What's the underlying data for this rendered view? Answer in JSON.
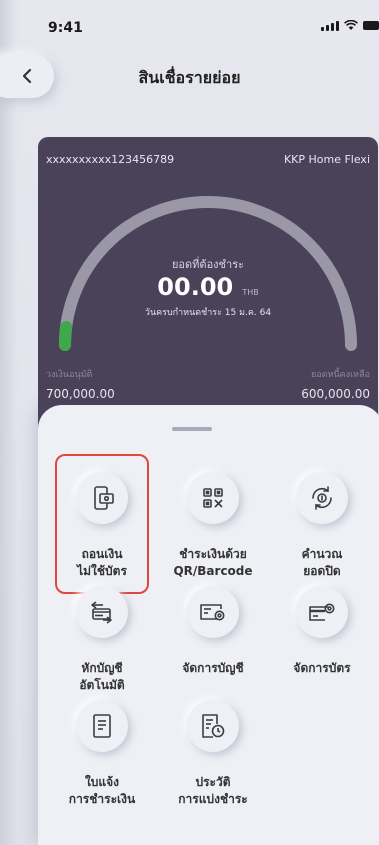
{
  "status_bar": {
    "time": "9:41"
  },
  "header": {
    "title": "สินเชื่อรายย่อย"
  },
  "card": {
    "account_number": "xxxxxxxxxx123456789",
    "product_name": "KKP Home Flexi",
    "due_label": "ยอดที่ต้องชำระ",
    "amount": "00.00",
    "currency": "THB",
    "due_date": "วันครบกำหนดชำระ 15 ม.ค. 64",
    "limit_label": "วงเงินอนุมัติ",
    "limit_value": "700,000.00",
    "remaining_label": "ยอดหนี้คงเหลือ",
    "remaining_value": "600,000.00",
    "gauge_color": "#9a98a6",
    "gauge_progress_color": "#3fa84a"
  },
  "menu": {
    "items": [
      {
        "label": "ถอนเงิน\nไม่ใช้บัตร",
        "icon": "phone-cash-icon",
        "highlighted": true
      },
      {
        "label": "ชำระเงินด้วย\nQR/Barcode",
        "icon": "qr-code-icon"
      },
      {
        "label": "คำนวณ\nยอดปิด",
        "icon": "calculate-cycle-icon"
      },
      {
        "label": "หักบัญชี\nอัตโนมัติ",
        "icon": "auto-debit-icon"
      },
      {
        "label": "จัดการบัญชี",
        "icon": "account-settings-icon"
      },
      {
        "label": "จัดการบัตร",
        "icon": "card-settings-icon"
      },
      {
        "label": "ใบแจ้ง\nการชำระเงิน",
        "icon": "payment-slip-icon"
      },
      {
        "label": "ประวัติ\nการแบ่งชำระ",
        "icon": "installment-history-icon"
      }
    ]
  },
  "colors": {
    "card_bg": "#4a4258",
    "highlight": "#e0483d",
    "sheet_bg": "#eef0f6"
  }
}
